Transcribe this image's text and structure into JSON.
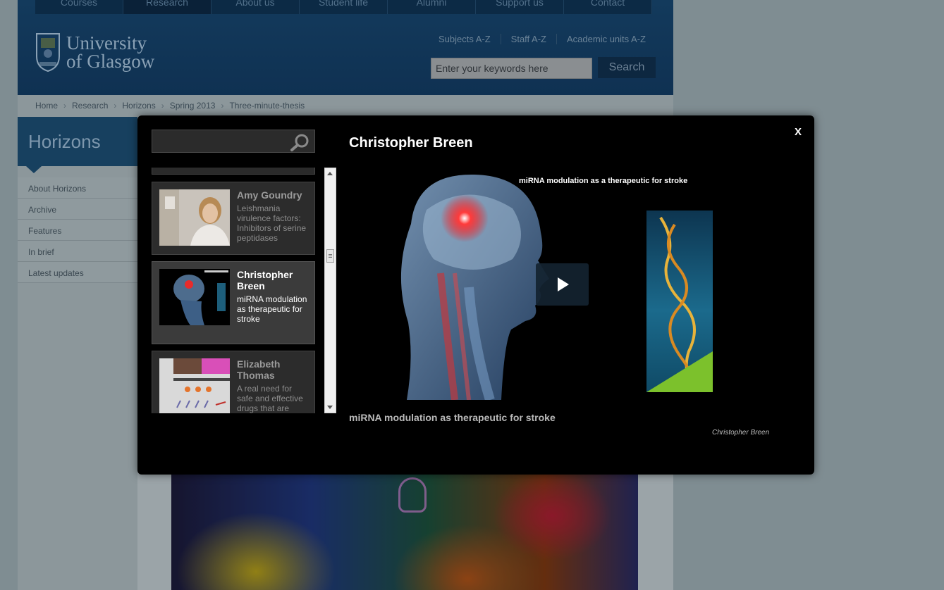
{
  "header": {
    "nav": [
      "Courses",
      "Research",
      "About us",
      "Student life",
      "Alumni",
      "Support us",
      "Contact"
    ],
    "active_nav": "Research",
    "logo_line1": "University",
    "logo_line2": "of Glasgow",
    "quicklinks": [
      "Subjects A-Z",
      "Staff A-Z",
      "Academic units A-Z"
    ],
    "search_placeholder": "Enter your keywords here",
    "search_button": "Search"
  },
  "breadcrumb": [
    "Home",
    "Research",
    "Horizons",
    "Spring 2013",
    "Three-minute-thesis"
  ],
  "section": {
    "title": "Horizons",
    "nav": [
      "About Horizons",
      "Archive",
      "Features",
      "In brief",
      "Latest updates"
    ]
  },
  "modal": {
    "close_label": "X",
    "search_value": "",
    "playlist": [
      {
        "name": "Amy Goundry",
        "desc": "Leishmania virulence factors: Inhibitors of serine peptidases",
        "active": false
      },
      {
        "name": "Christopher Breen",
        "desc": "miRNA modulation as therapeutic for stroke",
        "active": true
      },
      {
        "name": "Elizabeth Thomas",
        "desc": "A real need for safe and effective drugs that are",
        "active": false
      }
    ],
    "video": {
      "title": "Christopher Breen",
      "slide_caption": "miRNA modulation as a therapeutic for stroke",
      "subtitle": "miRNA modulation as therapeutic for stroke",
      "author": "Christopher Breen"
    }
  },
  "colors": {
    "header_bg": "#133a5c",
    "modal_bg": "#000000",
    "playlist_item_bg": "#2c2c2c",
    "playlist_active_bg": "#3b3b3b"
  }
}
